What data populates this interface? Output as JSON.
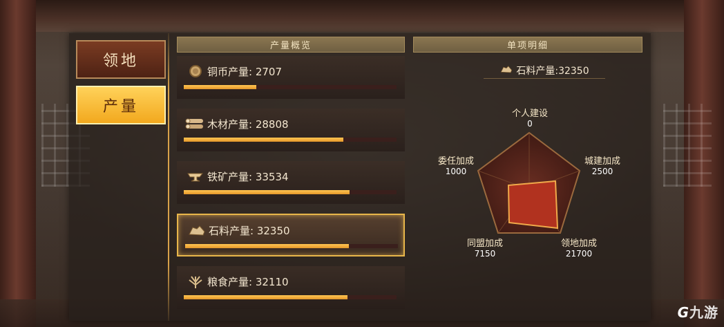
{
  "tabs": [
    {
      "label": "领地",
      "active": false
    },
    {
      "label": "产量",
      "active": true
    }
  ],
  "overview_header": "产量概览",
  "detail_header": "单项明细",
  "resources": [
    {
      "icon": "coin-icon",
      "label": "铜币产量:",
      "value": "2707",
      "fill": 0.34,
      "selected": false
    },
    {
      "icon": "wood-icon",
      "label": "木材产量:",
      "value": "28808",
      "fill": 0.75,
      "selected": false
    },
    {
      "icon": "iron-icon",
      "label": "铁矿产量:",
      "value": "33534",
      "fill": 0.78,
      "selected": false
    },
    {
      "icon": "stone-icon",
      "label": "石料产量:",
      "value": "32350",
      "fill": 0.77,
      "selected": true
    },
    {
      "icon": "grain-icon",
      "label": "粮食产量:",
      "value": "32110",
      "fill": 0.77,
      "selected": false
    }
  ],
  "detail": {
    "icon": "stone-icon",
    "title": "石料产量:32350",
    "radar": [
      {
        "name": "个人建设",
        "value": "0"
      },
      {
        "name": "城建加成",
        "value": "2500"
      },
      {
        "name": "领地加成",
        "value": "21700"
      },
      {
        "name": "同盟加成",
        "value": "7150"
      },
      {
        "name": "委任加成",
        "value": "1000"
      }
    ]
  },
  "watermark": "九游",
  "colors": {
    "accent": "#f2a81e",
    "bar": "#e5972a",
    "frame": "#d9a24a",
    "radar_fill": "#b1321f"
  }
}
